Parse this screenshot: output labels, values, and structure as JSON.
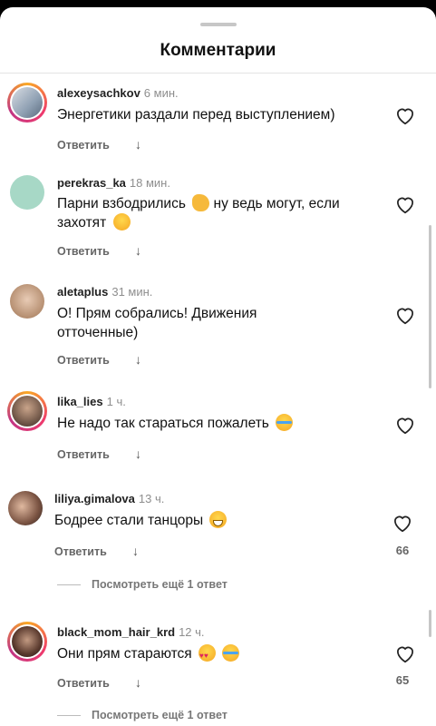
{
  "header": {
    "title": "Комментарии"
  },
  "comments": [
    {
      "username": "alexeysachkov",
      "time": "6 мин.",
      "text": "Энергетики раздали перед выступлением)",
      "reply_label": "Ответить",
      "emoji": []
    },
    {
      "username": "perekras_ka",
      "time": "18 мин.",
      "text": "Парни взбодрились",
      "text_after": "ну ведь могут, если захотят",
      "reply_label": "Ответить",
      "emoji": [
        "flexed-biceps",
        "winking-face"
      ]
    },
    {
      "username": "aletaplus",
      "time": "31 мин.",
      "text": "О! Прям собрались! Движения отточенные)",
      "reply_label": "Ответить",
      "emoji": []
    },
    {
      "username": "lika_lies",
      "time": "1 ч.",
      "text": "Не надо так стараться пожалеть",
      "reply_label": "Ответить",
      "emoji": [
        "face-with-tears-of-joy"
      ]
    },
    {
      "username": "liliya.gimalova",
      "time": "13 ч.",
      "text": "Бодрее стали танцоры",
      "reply_label": "Ответить",
      "likes": "66",
      "view_replies": "Посмотреть ещё 1 ответ",
      "emoji": [
        "grinning-face"
      ]
    },
    {
      "username": "black_mom_hair_krd",
      "time": "12 ч.",
      "text": "Они прям стараются",
      "reply_label": "Ответить",
      "likes": "65",
      "view_replies": "Посмотреть ещё 1 ответ",
      "emoji": [
        "heart-eyes-face",
        "face-with-tears-of-joy"
      ]
    }
  ],
  "icons": {
    "like": "heart-outline-icon",
    "reply_arrow": "arrow-down-icon"
  },
  "colors": {
    "story_ring": [
      "#f9a825",
      "#ef3b6d",
      "#c13584"
    ],
    "muted_text": "#8e8e8e"
  }
}
